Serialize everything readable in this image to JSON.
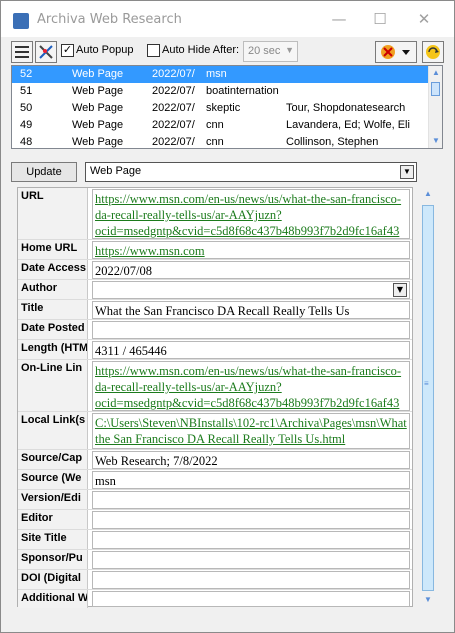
{
  "window": {
    "title": "Archiva Web Research",
    "minimize": "—",
    "maximize": "☐",
    "close": "✕"
  },
  "toolbar": {
    "auto_popup_label": "Auto Popup",
    "auto_popup_checked": "✓",
    "auto_hide_label": "Auto Hide After:",
    "auto_hide_value": "20 sec"
  },
  "list": {
    "rows": [
      {
        "id": "52",
        "type": "Web Page",
        "date": "2022/07/",
        "source": "msn",
        "author": ""
      },
      {
        "id": "51",
        "type": "Web Page",
        "date": "2022/07/",
        "source": "boatinternation",
        "author": ""
      },
      {
        "id": "50",
        "type": "Web Page",
        "date": "2022/07/",
        "source": "skeptic",
        "author": "Tour, Shopdonatesearch"
      },
      {
        "id": "49",
        "type": "Web Page",
        "date": "2022/07/",
        "source": "cnn",
        "author": "Lavandera, Ed; Wolfe, Eli"
      },
      {
        "id": "48",
        "type": "Web Page",
        "date": "2022/07/",
        "source": "cnn",
        "author": "Collinson, Stephen"
      }
    ]
  },
  "update_button": "Update",
  "record_type": "Web Page",
  "fields": {
    "url": {
      "label": "URL",
      "value": "https://www.msn.com/en-us/news/us/what-the-san-francisco-da-recall-really-tells-us/ar-AAYjuzn?ocid=msedgntp&cvid=c5d8f68c437b48b993f7b2d9fc16af43"
    },
    "home_url": {
      "label": "Home URL",
      "value": "https://www.msn.com"
    },
    "date_accessed": {
      "label": "Date Access",
      "value": "2022/07/08"
    },
    "author": {
      "label": "Author",
      "value": ""
    },
    "title": {
      "label": "Title",
      "value": "What the San Francisco DA Recall Really Tells Us"
    },
    "date_posted": {
      "label": "Date Posted",
      "value": ""
    },
    "length": {
      "label": "Length (HTM",
      "value": "4311 / 465446"
    },
    "online_link": {
      "label": "On-Line Lin",
      "value": "https://www.msn.com/en-us/news/us/what-the-san-francisco-da-recall-really-tells-us/ar-AAYjuzn?ocid=msedgntp&cvid=c5d8f68c437b48b993f7b2d9fc16af43"
    },
    "local_link": {
      "label": "Local Link(s",
      "value": "C:\\Users\\Steven\\NBInstalls\\102-rc1\\Archiva\\Pages\\msn\\What the San Francisco DA Recall Really Tells Us.html"
    },
    "source_caption": {
      "label": "Source/Cap",
      "value": "Web Research; 7/8/2022"
    },
    "source_web": {
      "label": "Source (We",
      "value": "msn"
    },
    "version": {
      "label": "Version/Edi",
      "value": ""
    },
    "editor": {
      "label": "Editor",
      "value": ""
    },
    "site_title": {
      "label": "Site Title",
      "value": ""
    },
    "sponsor": {
      "label": "Sponsor/Pu",
      "value": ""
    },
    "doi": {
      "label": "DOI (Digital",
      "value": ""
    },
    "additional": {
      "label": "Additional W",
      "value": ""
    }
  }
}
